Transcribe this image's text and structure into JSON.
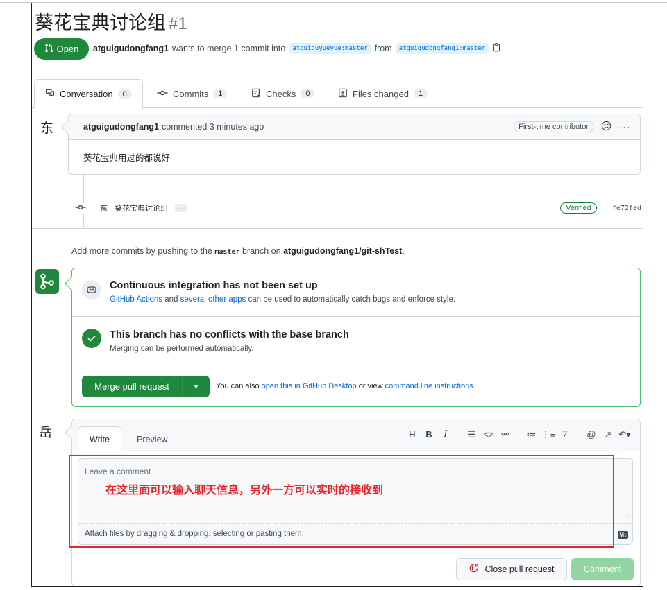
{
  "header": {
    "title": "葵花宝典讨论组",
    "number": "#1",
    "state": "Open",
    "author": "atguigudongfang1",
    "action_text": "wants to merge 1 commit into",
    "base_branch": "atguiguyueyue:master",
    "from_text": "from",
    "head_branch": "atguigudongfang1:master"
  },
  "tabs": [
    {
      "label": "Conversation",
      "count": "0",
      "icon": "conversation-icon"
    },
    {
      "label": "Commits",
      "count": "1",
      "icon": "commit-icon"
    },
    {
      "label": "Checks",
      "count": "0",
      "icon": "checks-icon"
    },
    {
      "label": "Files changed",
      "count": "1",
      "icon": "file-diff-icon"
    }
  ],
  "comment": {
    "avatar": "东",
    "author": "atguigudongfang1",
    "action": "commented 3 minutes ago",
    "badge": "First-time contributor",
    "body": "葵花宝典用过的都说好"
  },
  "commit": {
    "avatar": "东",
    "message": "葵花宝典讨论组",
    "ellipsis": "…",
    "verified": "Verified",
    "sha": "fe72fed"
  },
  "add_more": {
    "prefix": "Add more commits by pushing to the",
    "branch": "master",
    "middle": "branch on",
    "repo": "atguigudongfang1/git-shTest",
    "suffix": "."
  },
  "merge": {
    "ci_title": "Continuous integration has not been set up",
    "ci_link1": "GitHub Actions",
    "ci_and": "and",
    "ci_link2": "several other apps",
    "ci_rest": "can be used to automatically catch bugs and enforce style.",
    "nc_title": "This branch has no conflicts with the base branch",
    "nc_sub": "Merging can be performed automatically.",
    "button": "Merge pull request",
    "note_prefix": "You can also",
    "note_link1": "open this in GitHub Desktop",
    "note_or": "or view",
    "note_link2": "command line instructions",
    "note_suffix": "."
  },
  "editor": {
    "avatar": "岳",
    "tab_write": "Write",
    "tab_preview": "Preview",
    "toolbar": [
      "H",
      "B",
      "I",
      "quote",
      "code",
      "link",
      "ul",
      "ol",
      "task",
      "@",
      "ref",
      "reply"
    ],
    "placeholder": "Leave a comment",
    "attach": "Attach files by dragging & dropping, selecting or pasting them.",
    "md_badge": "M↓"
  },
  "annotation": "在这里面可以输入聊天信息，另外一方可以实时的接收到",
  "actions": {
    "close": "Close pull request",
    "comment": "Comment"
  },
  "colors": {
    "green": "#1f883d",
    "blue_link": "#0969da",
    "annotation_red": "#e8242a"
  }
}
